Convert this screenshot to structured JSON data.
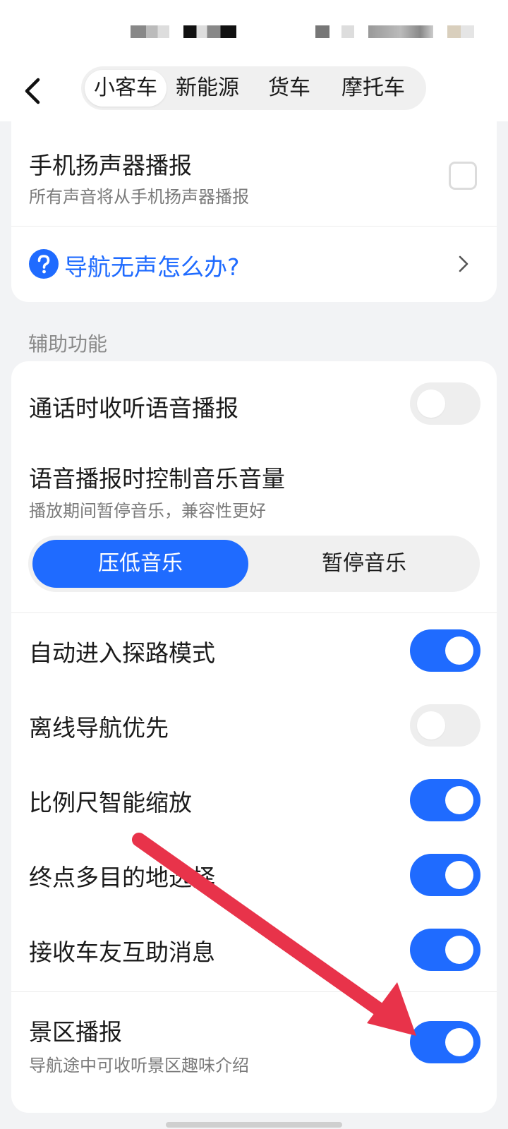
{
  "tabs": [
    {
      "label": "小客车",
      "active": true
    },
    {
      "label": "新能源",
      "active": false
    },
    {
      "label": "货车",
      "active": false
    },
    {
      "label": "摩托车",
      "active": false
    }
  ],
  "speaker": {
    "title": "手机扬声器播报",
    "subtitle": "所有声音将从手机扬声器播报",
    "checked": false
  },
  "help": {
    "label": "导航无声怎么办?"
  },
  "section": {
    "title": "辅助功能"
  },
  "call_listen": {
    "title": "通话时收听语音播报",
    "on": false
  },
  "music_control": {
    "title": "语音播报时控制音乐音量",
    "subtitle": "播放期间暂停音乐，兼容性更好",
    "options": [
      "压低音乐",
      "暂停音乐"
    ],
    "selected": "压低音乐"
  },
  "toggles": [
    {
      "title": "自动进入探路模式",
      "on": true
    },
    {
      "title": "离线导航优先",
      "on": false
    },
    {
      "title": "比例尺智能缩放",
      "on": true
    },
    {
      "title": "终点多目的地选择",
      "on": true
    },
    {
      "title": "接收车友互助消息",
      "on": true
    }
  ],
  "scenic": {
    "title": "景区播报",
    "subtitle": "导航途中可收听景区趣味介绍",
    "on": true
  },
  "colors": {
    "accent": "#1f6bff",
    "annotation_arrow": "#e8334a"
  },
  "icons": {
    "back": "chevron-left-icon",
    "help": "question-circle-icon",
    "chevron": "chevron-right-icon"
  }
}
